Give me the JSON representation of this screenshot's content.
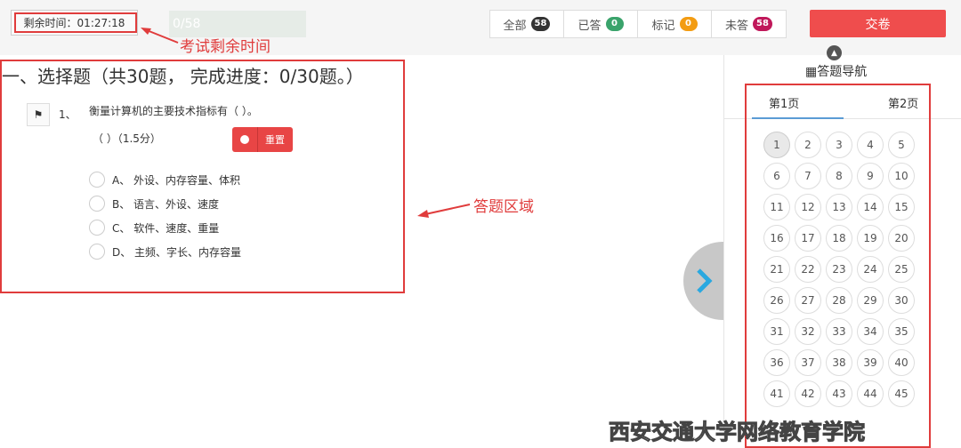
{
  "header": {
    "timer_text": "剩余时间：01:27:18",
    "progress_text": "0/58",
    "tabs": [
      {
        "label": "全部",
        "count": "58",
        "color": "#333333"
      },
      {
        "label": "已答",
        "count": "0",
        "color": "#3aa36b"
      },
      {
        "label": "标记",
        "count": "0",
        "color": "#f39c12"
      },
      {
        "label": "未答",
        "count": "58",
        "color": "#c0185a"
      }
    ],
    "submit_label": "交卷"
  },
  "annotations": {
    "timer": "考试剩余时间",
    "answer_area": "答题区域"
  },
  "question": {
    "section_title": "一、选择题（共30题， 完成进度：0/30题。）",
    "number": "1、",
    "text": "衡量计算机的主要技术指标有（ ）。",
    "blank": "（                    ）（1.5分）",
    "reset_label": "重置",
    "options": [
      "A、 外设、内存容量、体积",
      "B、 语言、外设、速度",
      "C、 软件、速度、重量",
      "D、 主频、字长、内存容量"
    ]
  },
  "navigator": {
    "title": "答题导航",
    "pages": [
      "第1页",
      "第2页"
    ],
    "numbers": [
      "1",
      "2",
      "3",
      "4",
      "5",
      "6",
      "7",
      "8",
      "9",
      "10",
      "11",
      "12",
      "13",
      "14",
      "15",
      "16",
      "17",
      "18",
      "19",
      "20",
      "21",
      "22",
      "23",
      "24",
      "25",
      "26",
      "27",
      "28",
      "29",
      "30",
      "31",
      "32",
      "33",
      "34",
      "35",
      "36",
      "37",
      "38",
      "39",
      "40",
      "41",
      "42",
      "43",
      "44",
      "45"
    ],
    "current": "1"
  },
  "watermark": "西安交通大学网络教育学院",
  "colors": {
    "accent": "#ef4d4d",
    "annotation": "#e03c3c",
    "next_arrow": "#2aa8e0"
  }
}
